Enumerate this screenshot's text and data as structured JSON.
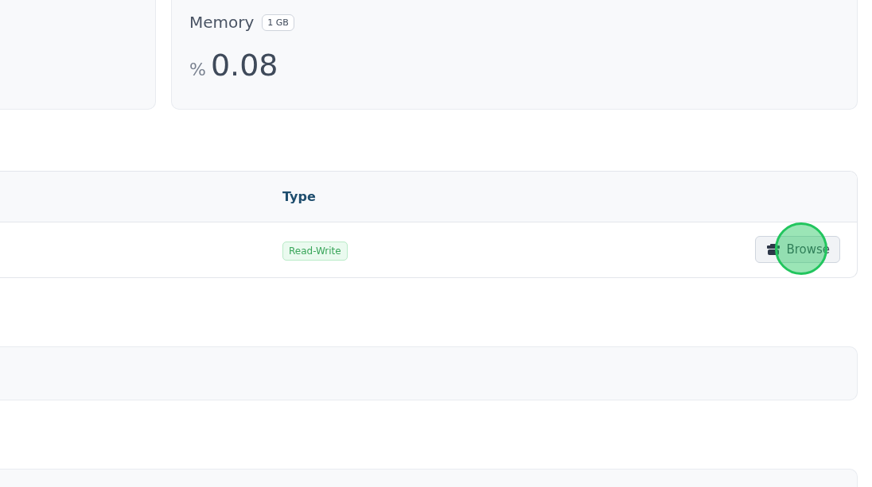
{
  "stat_card": {
    "label": "Memory",
    "badge": "1 GB",
    "unit": "%",
    "value": "0.08"
  },
  "table": {
    "columns": [
      "Type"
    ],
    "rows": [
      {
        "type": "Read-Write",
        "action": "Browse",
        "highlighted": true
      }
    ]
  }
}
